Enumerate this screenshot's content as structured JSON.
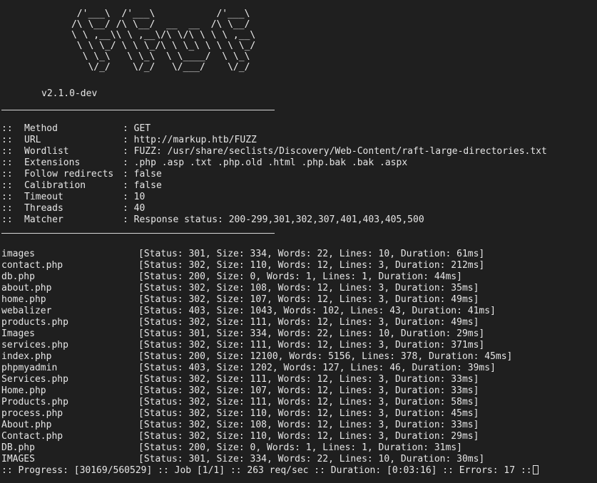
{
  "banner": {
    "ascii": "       /'___\\  /'___\\           /'___\\\n      /\\ \\__/ /\\ \\__/  __  __  /\\ \\__/\n      \\ \\ ,__\\\\ \\ ,__\\/\\ \\/\\ \\ \\ \\ ,__\\\n       \\ \\ \\_/ \\ \\ \\_/\\ \\ \\_\\ \\ \\ \\ \\_/\n        \\ \\_\\   \\ \\_\\  \\ \\____/  \\ \\_\\\n         \\/_/    \\/_/   \\/___/    \\/_/",
    "version": "v2.1.0-dev"
  },
  "config": [
    {
      "prefix": "::",
      "key": "Method",
      "value": "GET"
    },
    {
      "prefix": "::",
      "key": "URL",
      "value": "http://markup.htb/FUZZ"
    },
    {
      "prefix": "::",
      "key": "Wordlist",
      "value": "FUZZ: /usr/share/seclists/Discovery/Web-Content/raft-large-directories.txt"
    },
    {
      "prefix": "::",
      "key": "Extensions",
      "value": ".php .asp .txt .php.old .html .php.bak .bak .aspx"
    },
    {
      "prefix": "::",
      "key": "Follow redirects",
      "value": "false"
    },
    {
      "prefix": "::",
      "key": "Calibration",
      "value": "false"
    },
    {
      "prefix": "::",
      "key": "Timeout",
      "value": "10"
    },
    {
      "prefix": "::",
      "key": "Threads",
      "value": "40"
    },
    {
      "prefix": "::",
      "key": "Matcher",
      "value": "Response status: 200-299,301,302,307,401,403,405,500"
    }
  ],
  "results": [
    {
      "path": "images",
      "info": "[Status: 301, Size: 334, Words: 22, Lines: 10, Duration: 61ms]"
    },
    {
      "path": "contact.php",
      "info": "[Status: 302, Size: 110, Words: 12, Lines: 3, Duration: 212ms]"
    },
    {
      "path": "db.php",
      "info": "[Status: 200, Size: 0, Words: 1, Lines: 1, Duration: 44ms]"
    },
    {
      "path": "about.php",
      "info": "[Status: 302, Size: 108, Words: 12, Lines: 3, Duration: 35ms]"
    },
    {
      "path": "home.php",
      "info": "[Status: 302, Size: 107, Words: 12, Lines: 3, Duration: 49ms]"
    },
    {
      "path": "webalizer",
      "info": "[Status: 403, Size: 1043, Words: 102, Lines: 43, Duration: 41ms]"
    },
    {
      "path": "products.php",
      "info": "[Status: 302, Size: 111, Words: 12, Lines: 3, Duration: 49ms]"
    },
    {
      "path": "Images",
      "info": "[Status: 301, Size: 334, Words: 22, Lines: 10, Duration: 29ms]"
    },
    {
      "path": "services.php",
      "info": "[Status: 302, Size: 111, Words: 12, Lines: 3, Duration: 371ms]"
    },
    {
      "path": "index.php",
      "info": "[Status: 200, Size: 12100, Words: 5156, Lines: 378, Duration: 45ms]"
    },
    {
      "path": "phpmyadmin",
      "info": "[Status: 403, Size: 1202, Words: 127, Lines: 46, Duration: 39ms]"
    },
    {
      "path": "Services.php",
      "info": "[Status: 302, Size: 111, Words: 12, Lines: 3, Duration: 33ms]"
    },
    {
      "path": "Home.php",
      "info": "[Status: 302, Size: 107, Words: 12, Lines: 3, Duration: 33ms]"
    },
    {
      "path": "Products.php",
      "info": "[Status: 302, Size: 111, Words: 12, Lines: 3, Duration: 58ms]"
    },
    {
      "path": "process.php",
      "info": "[Status: 302, Size: 110, Words: 12, Lines: 3, Duration: 45ms]"
    },
    {
      "path": "About.php",
      "info": "[Status: 302, Size: 108, Words: 12, Lines: 3, Duration: 33ms]"
    },
    {
      "path": "Contact.php",
      "info": "[Status: 302, Size: 110, Words: 12, Lines: 3, Duration: 29ms]"
    },
    {
      "path": "DB.php",
      "info": "[Status: 200, Size: 0, Words: 1, Lines: 1, Duration: 31ms]"
    },
    {
      "path": "IMAGES",
      "info": "[Status: 301, Size: 334, Words: 22, Lines: 10, Duration: 30ms]"
    }
  ],
  "progress": {
    "text": ":: Progress: [30169/560529] :: Job [1/1] :: 263 req/sec :: Duration: [0:03:16] :: Errors: 17 ::"
  },
  "colors": {
    "background": "#1f1f1f",
    "foreground": "#e6e6e6"
  }
}
